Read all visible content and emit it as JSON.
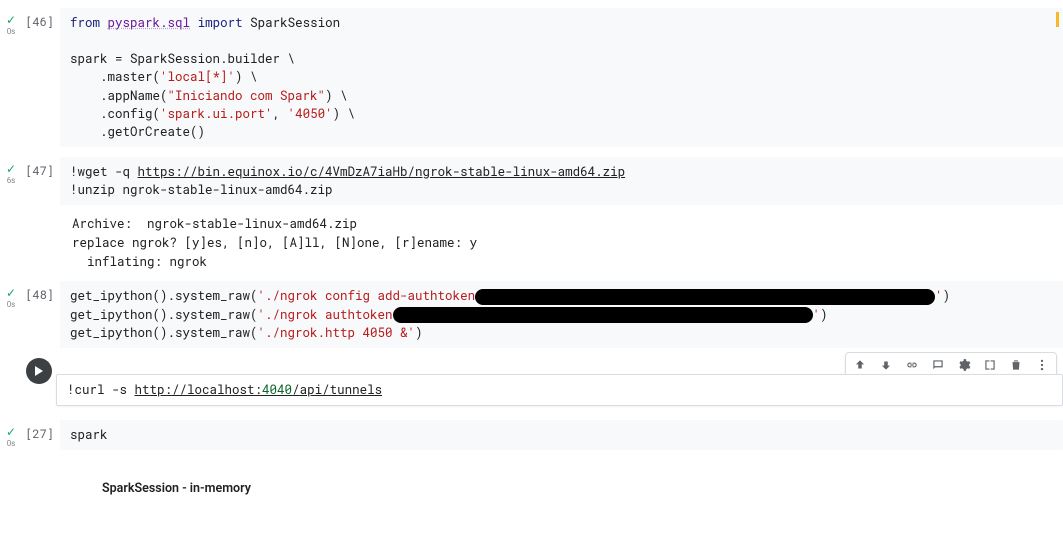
{
  "cells": [
    {
      "exec": "[46]",
      "timing": "0s",
      "status": "ok",
      "warn": true,
      "code": {
        "l1_from": "from",
        "l1_mod": "pyspark.sql",
        "l1_import": "import",
        "l1_name": "SparkSession",
        "l3_lhs": "spark = SparkSession.builder \\",
        "l4_a": "    .master(",
        "l4_s": "'local[*]'",
        "l4_b": ") \\",
        "l5_a": "    .appName(",
        "l5_s": "\"Iniciando com Spark\"",
        "l5_b": ") \\",
        "l6_a": "    .config(",
        "l6_s1": "'spark.ui.port'",
        "l6_c": ", ",
        "l6_s2": "'4050'",
        "l6_b": ") \\",
        "l7_a": "    .getOrCreate()"
      }
    },
    {
      "exec": "[47]",
      "timing": "6s",
      "status": "ok",
      "code": {
        "l1_a": "!wget -q ",
        "l1_url": "https://bin.equinox.io/c/4VmDzA7iaHb/ngrok-stable-linux-amd64.zip",
        "l2": "!unzip ngrok-stable-linux-amd64.zip"
      },
      "output": "Archive:  ngrok-stable-linux-amd64.zip\nreplace ngrok? [y]es, [n]o, [A]ll, [N]one, [r]ename: y\n  inflating: ngrok"
    },
    {
      "exec": "[48]",
      "timing": "0s",
      "status": "ok",
      "code": {
        "l1_a": "get_ipython().system_raw(",
        "l1_s": "'./ngrok config add-authtoken",
        "l1_b": "'",
        "l1_c": ")",
        "l2_a": "get_ipython().system_raw(",
        "l2_s": "'./ngrok authtoken",
        "l2_b": "'",
        "l2_c": ")",
        "l3_a": "get_ipython().system_raw(",
        "l3_s": "'./ngrok.http 4050 &'",
        "l3_c": ")"
      }
    },
    {
      "current": true,
      "timing": "",
      "code": {
        "l1_a": "!curl -s ",
        "l1_host": "http://localhost:",
        "l1_port": "4040",
        "l1_path": "/api/tunnels"
      }
    },
    {
      "exec": "[27]",
      "timing": "0s",
      "status": "ok",
      "code": {
        "l1": "spark"
      },
      "out_html": "SparkSession - in-memory"
    }
  ],
  "toolbar_labels": {
    "up": "move-up",
    "down": "move-down",
    "link": "link",
    "comment": "comment",
    "settings": "settings",
    "mirror": "mirror",
    "delete": "delete",
    "more": "more"
  }
}
